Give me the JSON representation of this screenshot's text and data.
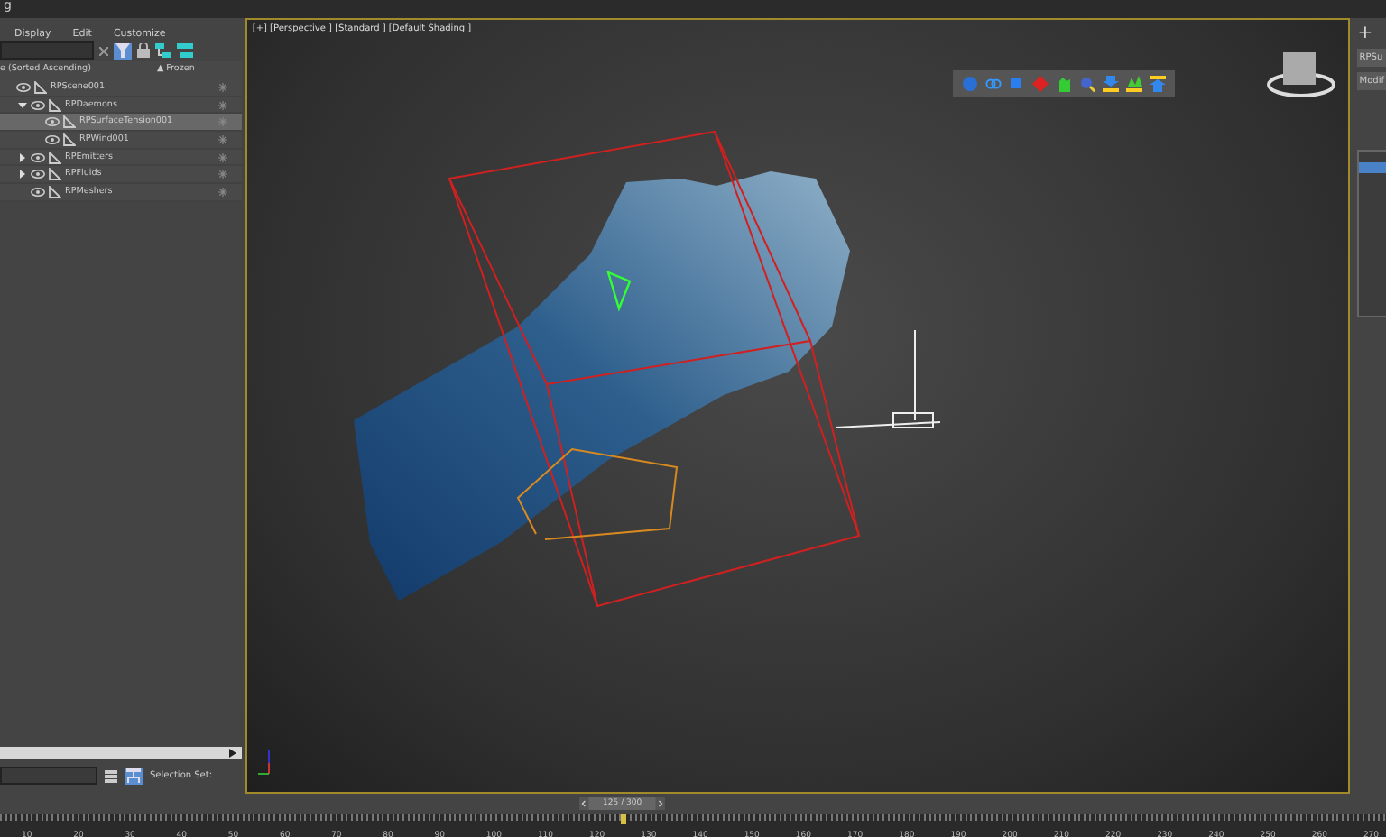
{
  "window": {
    "title": "g"
  },
  "menu": [
    "Display",
    "Edit",
    "Customize"
  ],
  "scene_explorer": {
    "column_header": "e (Sorted Ascending)",
    "frozen_header": "▲ Frozen",
    "filter_on": true,
    "items": [
      {
        "label": "RPScene001",
        "selected": false,
        "children": [
          {
            "label": "RPDaemons",
            "expanded": true,
            "selected": false,
            "children": [
              {
                "label": "RPSurfaceTension001",
                "selected": true
              },
              {
                "label": "RPWind001",
                "selected": false
              }
            ]
          },
          {
            "label": "RPEmitters",
            "expanded": false,
            "selected": false
          },
          {
            "label": "RPFluids",
            "expanded": false,
            "selected": false
          },
          {
            "label": "RPMeshers",
            "selected": false
          }
        ]
      }
    ]
  },
  "selection_set": {
    "label": "Selection Set:"
  },
  "viewport": {
    "label": "[+] [Perspective ] [Standard ] [Default Shading ]"
  },
  "command_panel": {
    "plus": "+",
    "name_field": "RPSu",
    "modifier_list": "Modif"
  },
  "timeline": {
    "frame": "125 / 300",
    "level": 0.449,
    "ticks": [
      "10",
      "20",
      "30",
      "40",
      "50",
      "60",
      "70",
      "80",
      "90",
      "100",
      "110",
      "120",
      "130",
      "140",
      "150",
      "160",
      "170",
      "180",
      "190",
      "200",
      "210",
      "220",
      "230",
      "240",
      "250",
      "260",
      "270"
    ]
  }
}
